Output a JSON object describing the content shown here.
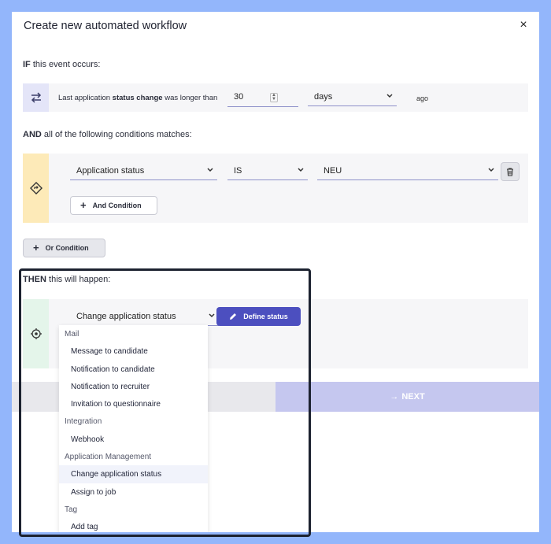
{
  "modal": {
    "title": "Create new automated workflow",
    "close_label": "×"
  },
  "if_section": {
    "prefix": "IF",
    "label": "this event occurs:",
    "event_text_pre": "Last application ",
    "event_text_bold": "status change",
    "event_text_post": " was longer than",
    "days_value": "30",
    "unit_selected": "days",
    "suffix": "ago"
  },
  "and_section": {
    "prefix": "AND",
    "label": "all of the following conditions matches:",
    "condition_field": "Application status",
    "condition_operator": "IS",
    "condition_value": "NEU",
    "and_condition_label": "And Condition",
    "or_condition_label": "Or Condition"
  },
  "then_section": {
    "prefix": "THEN",
    "label": "this will happen:",
    "action_selected": "Change application status",
    "define_status_label": "Define status"
  },
  "footer": {
    "next_label": "NEXT",
    "next_arrow": "→"
  },
  "dropdown": {
    "groups": [
      {
        "label": "Mail",
        "items": [
          "Message to candidate",
          "Notification to candidate",
          "Notification to recruiter",
          "Invitation to questionnaire"
        ]
      },
      {
        "label": "Integration",
        "items": [
          "Webhook"
        ]
      },
      {
        "label": "Application Management",
        "items": [
          "Change application status",
          "Assign to job"
        ]
      },
      {
        "label": "Tag",
        "items": [
          "Add tag"
        ]
      }
    ],
    "selected": "Change application status"
  },
  "colors": {
    "page_bg": "#93b6fb",
    "accent": "#4c4fbf",
    "next_bg": "#c5c7ef",
    "if_icon_bg": "#e4e5f8",
    "and_icon_bg": "#fdeab8",
    "then_icon_bg": "#e4f5ea"
  }
}
